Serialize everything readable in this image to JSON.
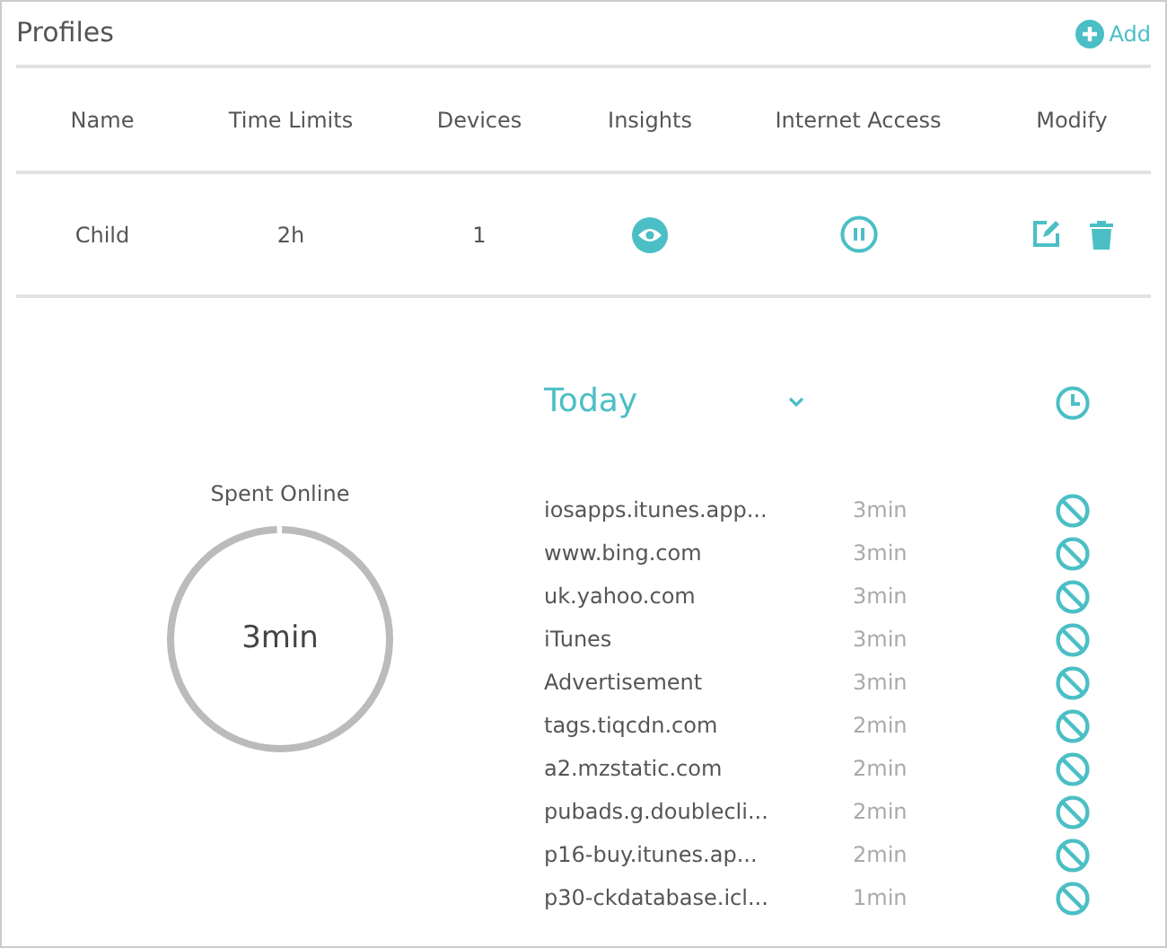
{
  "title": "Profiles",
  "add_button": {
    "label": "Add"
  },
  "table": {
    "columns": [
      "Name",
      "Time Limits",
      "Devices",
      "Insights",
      "Internet Access",
      "Modify"
    ],
    "rows": [
      {
        "name": "Child",
        "time_limit": "2h",
        "devices": "1"
      }
    ]
  },
  "insights": {
    "period": "Today",
    "spent_label": "Spent Online",
    "spent_value": "3min",
    "sites": [
      {
        "name": "iosapps.itunes.app...",
        "time": "3min"
      },
      {
        "name": "www.bing.com",
        "time": "3min"
      },
      {
        "name": "uk.yahoo.com",
        "time": "3min"
      },
      {
        "name": "iTunes",
        "time": "3min"
      },
      {
        "name": "Advertisement",
        "time": "3min"
      },
      {
        "name": "tags.tiqcdn.com",
        "time": "2min"
      },
      {
        "name": "a2.mzstatic.com",
        "time": "2min"
      },
      {
        "name": "pubads.g.doublecli...",
        "time": "2min"
      },
      {
        "name": "p16-buy.itunes.ap...",
        "time": "2min"
      },
      {
        "name": "p30-ckdatabase.icl...",
        "time": "1min"
      }
    ]
  }
}
